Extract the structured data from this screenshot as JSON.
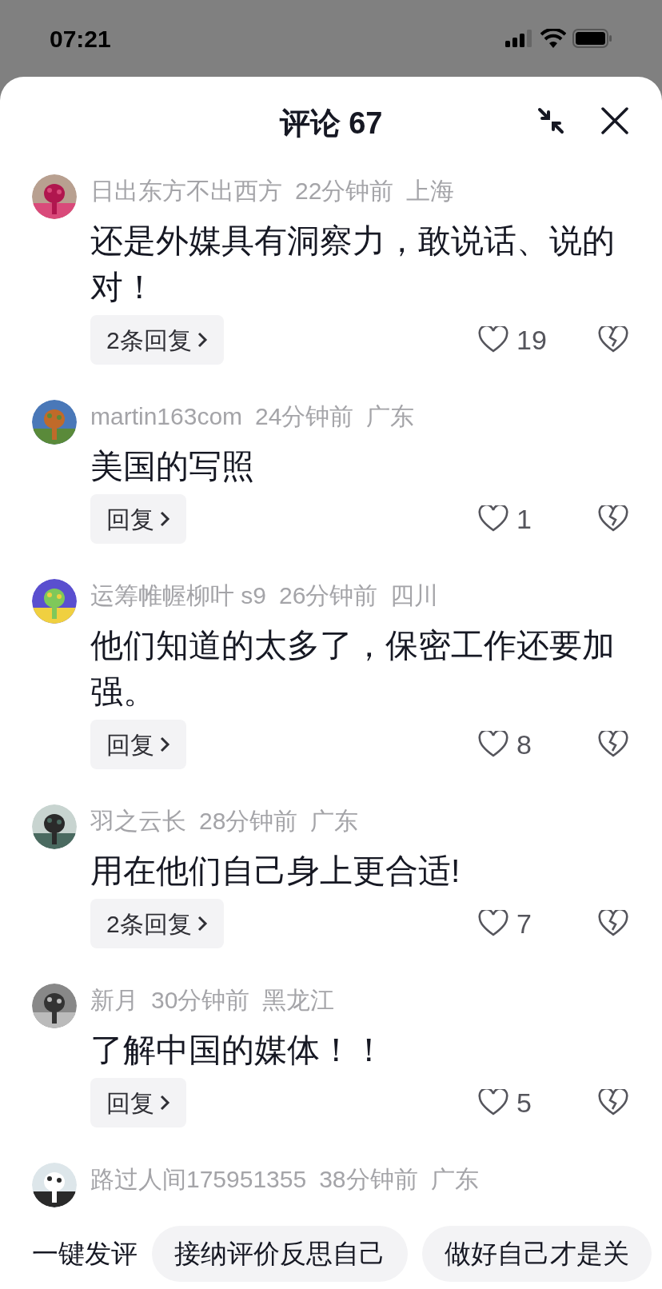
{
  "status_bar": {
    "time": "07:21"
  },
  "header": {
    "title": "评论 67"
  },
  "comments": [
    {
      "user": "日出东方不出西方",
      "time": "22分钟前",
      "location": "上海",
      "text": "还是外媒具有洞察力，敢说话、说的对！",
      "replies": "2条回复",
      "likes": "19"
    },
    {
      "user": "martin163com",
      "time": "24分钟前",
      "location": "广东",
      "text": "美国的写照",
      "replies": "回复",
      "likes": "1"
    },
    {
      "user": "运筹帷幄柳叶 s9",
      "time": "26分钟前",
      "location": "四川",
      "text": "他们知道的太多了，保密工作还要加强。",
      "replies": "回复",
      "likes": "8"
    },
    {
      "user": "羽之云长",
      "time": "28分钟前",
      "location": "广东",
      "text": "用在他们自己身上更合适!",
      "replies": "2条回复",
      "likes": "7"
    },
    {
      "user": "新月",
      "time": "30分钟前",
      "location": "黑龙江",
      "text": "了解中国的媒体！！",
      "replies": "回复",
      "likes": "5"
    },
    {
      "user": "路过人间175951355",
      "time": "38分钟前",
      "location": "广东"
    }
  ],
  "quick_comments": {
    "label": "一键发评",
    "chips": [
      "接纳评价反思自己",
      "做好自己才是关"
    ]
  }
}
